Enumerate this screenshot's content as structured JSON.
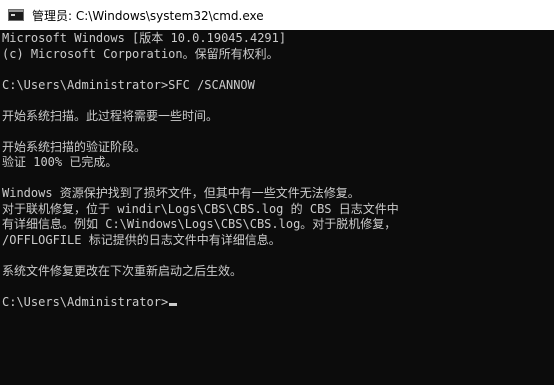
{
  "window": {
    "title": "管理员: C:\\Windows\\system32\\cmd.exe",
    "icon": "cmd-console-icon"
  },
  "console": {
    "lines": [
      "Microsoft Windows [版本 10.0.19045.4291]",
      "(c) Microsoft Corporation。保留所有权利。",
      "",
      "C:\\Users\\Administrator>SFC /SCANNOW",
      "",
      "开始系统扫描。此过程将需要一些时间。",
      "",
      "开始系统扫描的验证阶段。",
      "验证 100% 已完成。",
      "",
      "Windows 资源保护找到了损坏文件，但其中有一些文件无法修复。",
      "对于联机修复，位于 windir\\Logs\\CBS\\CBS.log 的 CBS 日志文件中",
      "有详细信息。例如 C:\\Windows\\Logs\\CBS\\CBS.log。对于脱机修复，",
      "/OFFLOGFILE 标记提供的日志文件中有详细信息。",
      "",
      "系统文件修复更改在下次重新启动之后生效。",
      ""
    ],
    "prompt": "C:\\Users\\Administrator>"
  }
}
